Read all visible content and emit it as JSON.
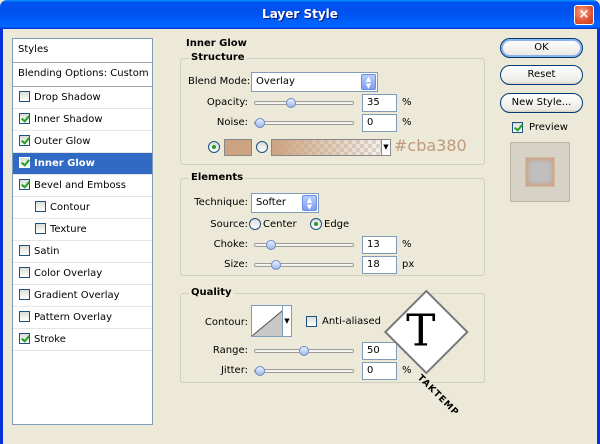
{
  "window": {
    "title": "Layer Style",
    "close_glyph": "×"
  },
  "styles_panel": {
    "header": "Styles",
    "blending": "Blending Options: Custom",
    "items": [
      {
        "label": "Drop Shadow",
        "checked": false,
        "indent": false,
        "selected": false
      },
      {
        "label": "Inner Shadow",
        "checked": true,
        "indent": false,
        "selected": false
      },
      {
        "label": "Outer Glow",
        "checked": true,
        "indent": false,
        "selected": false
      },
      {
        "label": "Inner Glow",
        "checked": true,
        "indent": false,
        "selected": true
      },
      {
        "label": "Bevel and Emboss",
        "checked": true,
        "indent": false,
        "selected": false
      },
      {
        "label": "Contour",
        "checked": false,
        "indent": true,
        "selected": false
      },
      {
        "label": "Texture",
        "checked": false,
        "indent": true,
        "selected": false
      },
      {
        "label": "Satin",
        "checked": false,
        "indent": false,
        "selected": false
      },
      {
        "label": "Color Overlay",
        "checked": false,
        "indent": false,
        "selected": false
      },
      {
        "label": "Gradient Overlay",
        "checked": false,
        "indent": false,
        "selected": false
      },
      {
        "label": "Pattern Overlay",
        "checked": false,
        "indent": false,
        "selected": false
      },
      {
        "label": "Stroke",
        "checked": true,
        "indent": false,
        "selected": false
      }
    ]
  },
  "main": {
    "title": "Inner Glow",
    "structure": {
      "label": "Structure",
      "blend_mode_label": "Blend Mode:",
      "blend_mode_value": "Overlay",
      "opacity_label": "Opacity:",
      "opacity_value": "35",
      "opacity_pct": 35,
      "opacity_unit": "%",
      "noise_label": "Noise:",
      "noise_value": "0",
      "noise_pct": 0,
      "noise_unit": "%",
      "color_hex_text": "#cba380",
      "glow_color": "#cba380"
    },
    "elements": {
      "label": "Elements",
      "technique_label": "Technique:",
      "technique_value": "Softer",
      "source_label": "Source:",
      "source_center": "Center",
      "source_edge": "Edge",
      "choke_label": "Choke:",
      "choke_value": "13",
      "choke_pct": 13,
      "choke_unit": "%",
      "size_label": "Size:",
      "size_value": "18",
      "size_pct": 18,
      "size_unit": "px"
    },
    "quality": {
      "label": "Quality",
      "contour_label": "Contour:",
      "anti_aliased_label": "Anti-aliased",
      "range_label": "Range:",
      "range_value": "50",
      "range_pct": 50,
      "range_unit": "%",
      "jitter_label": "Jitter:",
      "jitter_value": "0",
      "jitter_pct": 0,
      "jitter_unit": "%"
    }
  },
  "buttons": {
    "ok": "OK",
    "reset": "Reset",
    "new_style": "New Style...",
    "preview_label": "Preview",
    "preview_checked": true
  },
  "logo": {
    "letter": "T",
    "text": "TAKTEMP"
  }
}
